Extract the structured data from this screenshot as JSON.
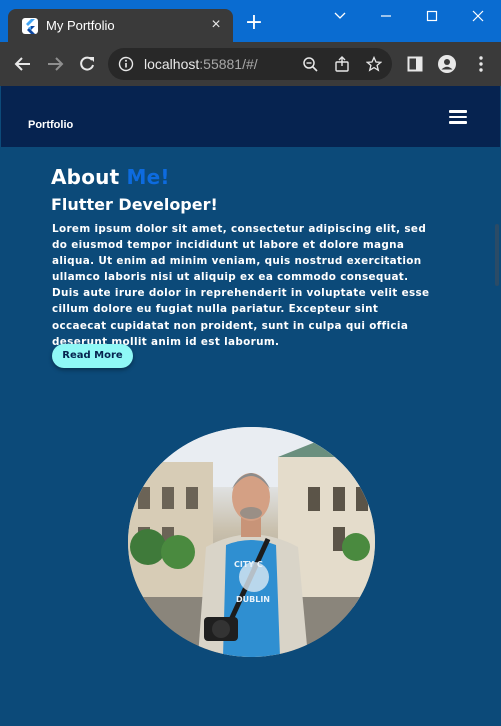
{
  "browser": {
    "tab_title": "My Portfolio",
    "tab_close_glyph": "×",
    "new_tab_glyph": "+",
    "url_host": "localhost",
    "url_rest": ":55881/#/",
    "icons": [
      "flutter-favicon",
      "back-arrow-icon",
      "forward-arrow-icon",
      "reload-icon",
      "info-icon",
      "zoom-icon",
      "share-icon",
      "star-icon",
      "side-panel-icon",
      "profile-icon",
      "kebab-menu-icon",
      "minimize-icon",
      "maximize-icon",
      "close-icon",
      "chevron-down-icon"
    ]
  },
  "app": {
    "brand": "Portfolio",
    "about_heading_white": "About ",
    "about_heading_blue": "Me!",
    "subtitle": "Flutter Developer!",
    "body_text": "Lorem ipsum dolor sit amet, consectetur adipiscing elit, sed do eiusmod tempor incididunt ut labore et dolore magna aliqua. Ut enim ad minim veniam, quis nostrud exercitation ullamco laboris nisi ut aliquip ex ea commodo consequat. Duis aute irure dolor in reprehenderit in voluptate velit esse cillum dolore eu fugiat nulla pariatur. Excepteur sint occaecat cupidatat non proident, sunt in culpa qui officia deserunt mollit anim id est laborum.",
    "read_more_label": "Read More",
    "photo_shirt_text_1": "CITY C",
    "photo_shirt_text_2": "DUBLIN"
  },
  "colors": {
    "page_background": "#0c4a79",
    "app_bar": "#062350",
    "accent_blue": "#0d6bdf",
    "button": "#8ff8f6",
    "browser_titlebar": "#0a6cd1"
  }
}
